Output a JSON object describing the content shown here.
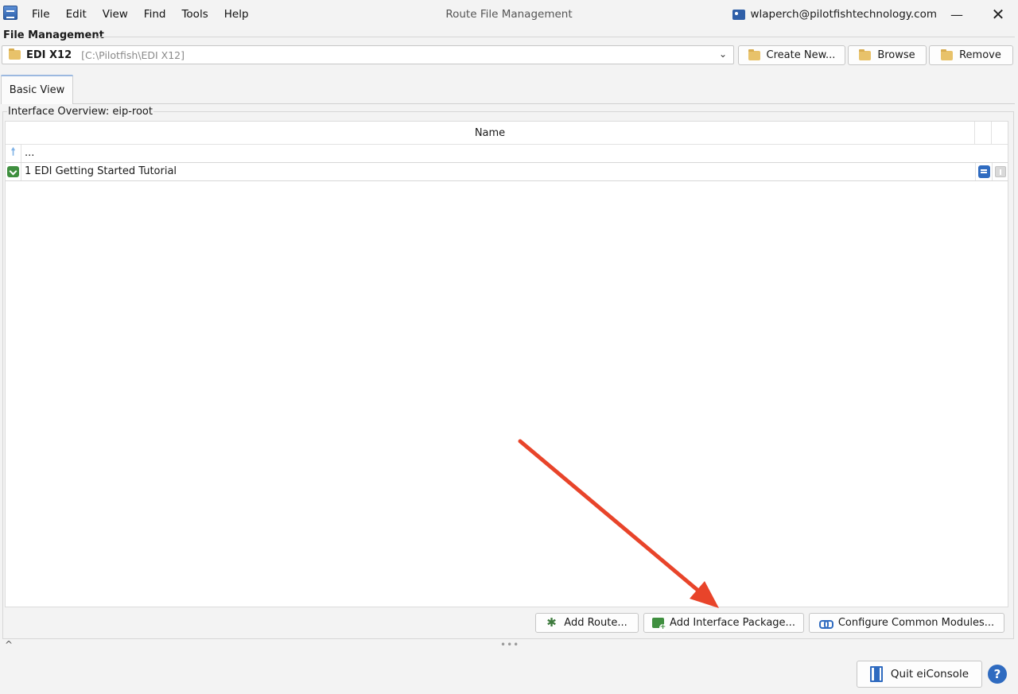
{
  "window": {
    "title": "Route File Management",
    "user_email": "wlaperch@pilotfishtechnology.com",
    "minimize_glyph": "—",
    "close_glyph": "✕"
  },
  "menu": [
    "File",
    "Edit",
    "View",
    "Find",
    "Tools",
    "Help"
  ],
  "file_management": {
    "section_label": "File Management",
    "selected_name": "EDI X12",
    "selected_path": "[C:\\Pilotfish\\EDI X12]",
    "chevron_glyph": "⌄",
    "buttons": {
      "create_new": "Create New...",
      "browse": "Browse",
      "remove": "Remove"
    }
  },
  "tabs": [
    {
      "label": "Basic View"
    }
  ],
  "interface_overview": {
    "title": "Interface Overview: eip-root",
    "column_name": "Name",
    "rows": [
      {
        "label": "...",
        "icon": "up-arrow-icon",
        "up_glyph": "🠕"
      },
      {
        "label": "1 EDI Getting Started Tutorial",
        "icon": "interface-package-icon"
      }
    ]
  },
  "actions": {
    "add_route": "Add Route...",
    "add_interface_package": "Add Interface Package...",
    "configure_common_modules": "Configure Common Modules..."
  },
  "splitter": {
    "caret_glyph": "^",
    "dots_glyph": "•••"
  },
  "footer": {
    "quit_label": "Quit eiConsole",
    "help_glyph": "?"
  },
  "colors": {
    "accent": "#2f6bc0",
    "arrow": "#e8442a",
    "folder": "#e8c26a",
    "package": "#3f8f3f"
  }
}
